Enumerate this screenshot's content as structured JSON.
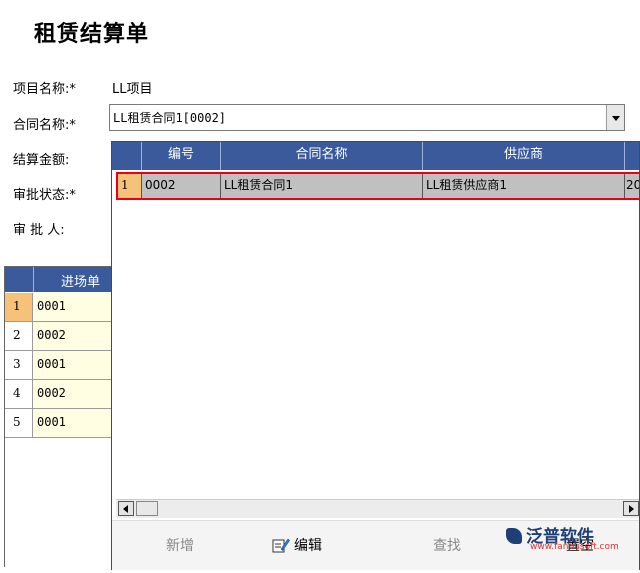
{
  "page_title": "租赁结算单",
  "form": {
    "project_label": "项目名称:*",
    "project_value": "LL项目",
    "contract_label": "合同名称:*",
    "contract_value": "LL租赁合同1[0002]",
    "amount_label": "结算金额:",
    "status_label": "审批状态:*",
    "approver_label": "审 批 人:"
  },
  "bg_grid": {
    "column": "进场单",
    "rows": [
      {
        "n": "1",
        "v": "0001"
      },
      {
        "n": "2",
        "v": "0002"
      },
      {
        "n": "3",
        "v": "0001"
      },
      {
        "n": "4",
        "v": "0002"
      },
      {
        "n": "5",
        "v": "0001"
      }
    ]
  },
  "dropdown": {
    "columns": [
      "编号",
      "合同名称",
      "供应商"
    ],
    "row": {
      "n": "1",
      "code": "0002",
      "name": "LL租赁合同1",
      "supplier": "LL租赁供应商1",
      "extra": "20"
    },
    "toolbar": {
      "add": "新增",
      "edit": "编辑",
      "find": "查找",
      "reset": "置空"
    }
  },
  "watermark": {
    "brand": "泛普软件",
    "url": "www.fanpusoft.com"
  }
}
